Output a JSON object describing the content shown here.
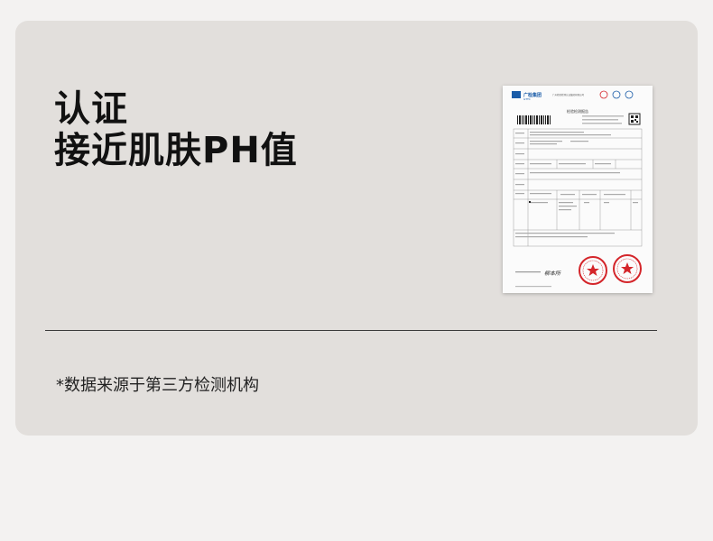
{
  "headline": {
    "line1": "认证",
    "line2": "接近肌肤PH值"
  },
  "footnote": "*数据来源于第三方检测机构",
  "report": {
    "org_name": "广检集团",
    "org_sub": "GTTC",
    "org_line": "广州检验检测认证集团有限公司",
    "title": "检验检测报告",
    "signature": "柳本所"
  },
  "colors": {
    "card": "#e2dfdc",
    "page": "#f3f2f1",
    "text": "#111111",
    "stamp": "#d4252a",
    "brand_blue": "#1a5ca8"
  }
}
